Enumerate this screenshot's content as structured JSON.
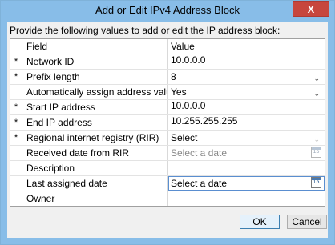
{
  "window": {
    "title": "Add or Edit IPv4 Address Block",
    "close_glyph": "X"
  },
  "instruction": "Provide the following values to add or edit the IP address block:",
  "grid": {
    "headers": {
      "field": "Field",
      "value": "Value"
    },
    "rows": [
      {
        "required": "*",
        "field": "Network ID",
        "value": "10.0.0.0",
        "kind": "text"
      },
      {
        "required": "*",
        "field": "Prefix length",
        "value": "8",
        "kind": "combo"
      },
      {
        "required": "",
        "field": "Automatically assign address values",
        "value": "Yes",
        "kind": "combo"
      },
      {
        "required": "*",
        "field": "Start IP address",
        "value": "10.0.0.0",
        "kind": "text"
      },
      {
        "required": "*",
        "field": "End IP address",
        "value": "10.255.255.255",
        "kind": "text"
      },
      {
        "required": "*",
        "field": "Regional internet registry (RIR)",
        "value": "Select",
        "kind": "combo-disabled"
      },
      {
        "required": "",
        "field": "Received date from RIR",
        "value": "Select a date",
        "kind": "date-disabled"
      },
      {
        "required": "",
        "field": "Description",
        "value": "",
        "kind": "text"
      },
      {
        "required": "",
        "field": "Last assigned date",
        "value": "Select a date",
        "kind": "date"
      },
      {
        "required": "",
        "field": "Owner",
        "value": "",
        "kind": "text"
      }
    ],
    "combo_arrow_glyph": "⌄",
    "date_icon_text": "15"
  },
  "buttons": {
    "ok": "OK",
    "cancel": "Cancel"
  }
}
